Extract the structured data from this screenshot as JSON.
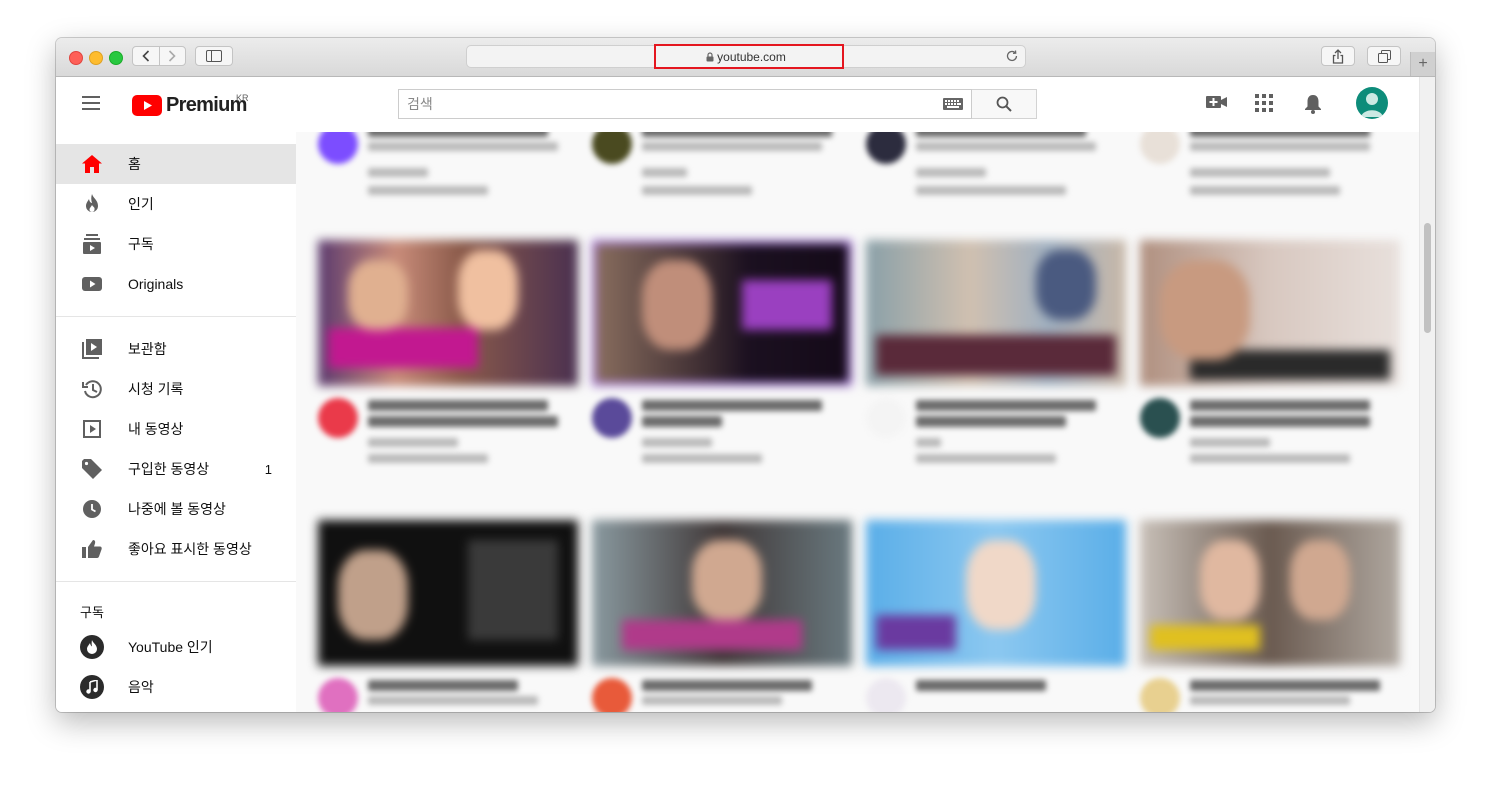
{
  "browser": {
    "url": "youtube.com",
    "highlight_color": "#e4161f"
  },
  "masthead": {
    "logo_text": "Premium",
    "region": "KR",
    "search_placeholder": "검색",
    "brand_color": "#ff0000",
    "icons": [
      "menu-icon",
      "create-video-icon",
      "apps-icon",
      "notifications-icon",
      "avatar"
    ]
  },
  "sidebar": {
    "main": [
      {
        "label": "홈",
        "icon": "home-icon",
        "active": true
      },
      {
        "label": "인기",
        "icon": "trending-icon"
      },
      {
        "label": "구독",
        "icon": "subscriptions-icon"
      },
      {
        "label": "Originals",
        "icon": "originals-icon"
      }
    ],
    "library": [
      {
        "label": "보관함",
        "icon": "library-icon"
      },
      {
        "label": "시청 기록",
        "icon": "history-icon"
      },
      {
        "label": "내 동영상",
        "icon": "your-videos-icon"
      },
      {
        "label": "구입한 동영상",
        "icon": "purchases-icon",
        "badge": "1"
      },
      {
        "label": "나중에 볼 동영상",
        "icon": "watch-later-icon"
      },
      {
        "label": "좋아요 표시한 동영상",
        "icon": "liked-icon"
      }
    ],
    "subscriptions_title": "구독",
    "subscriptions": [
      {
        "label": "YouTube 인기",
        "icon": "youtube-popular-icon"
      },
      {
        "label": "음악",
        "icon": "music-icon"
      }
    ]
  }
}
